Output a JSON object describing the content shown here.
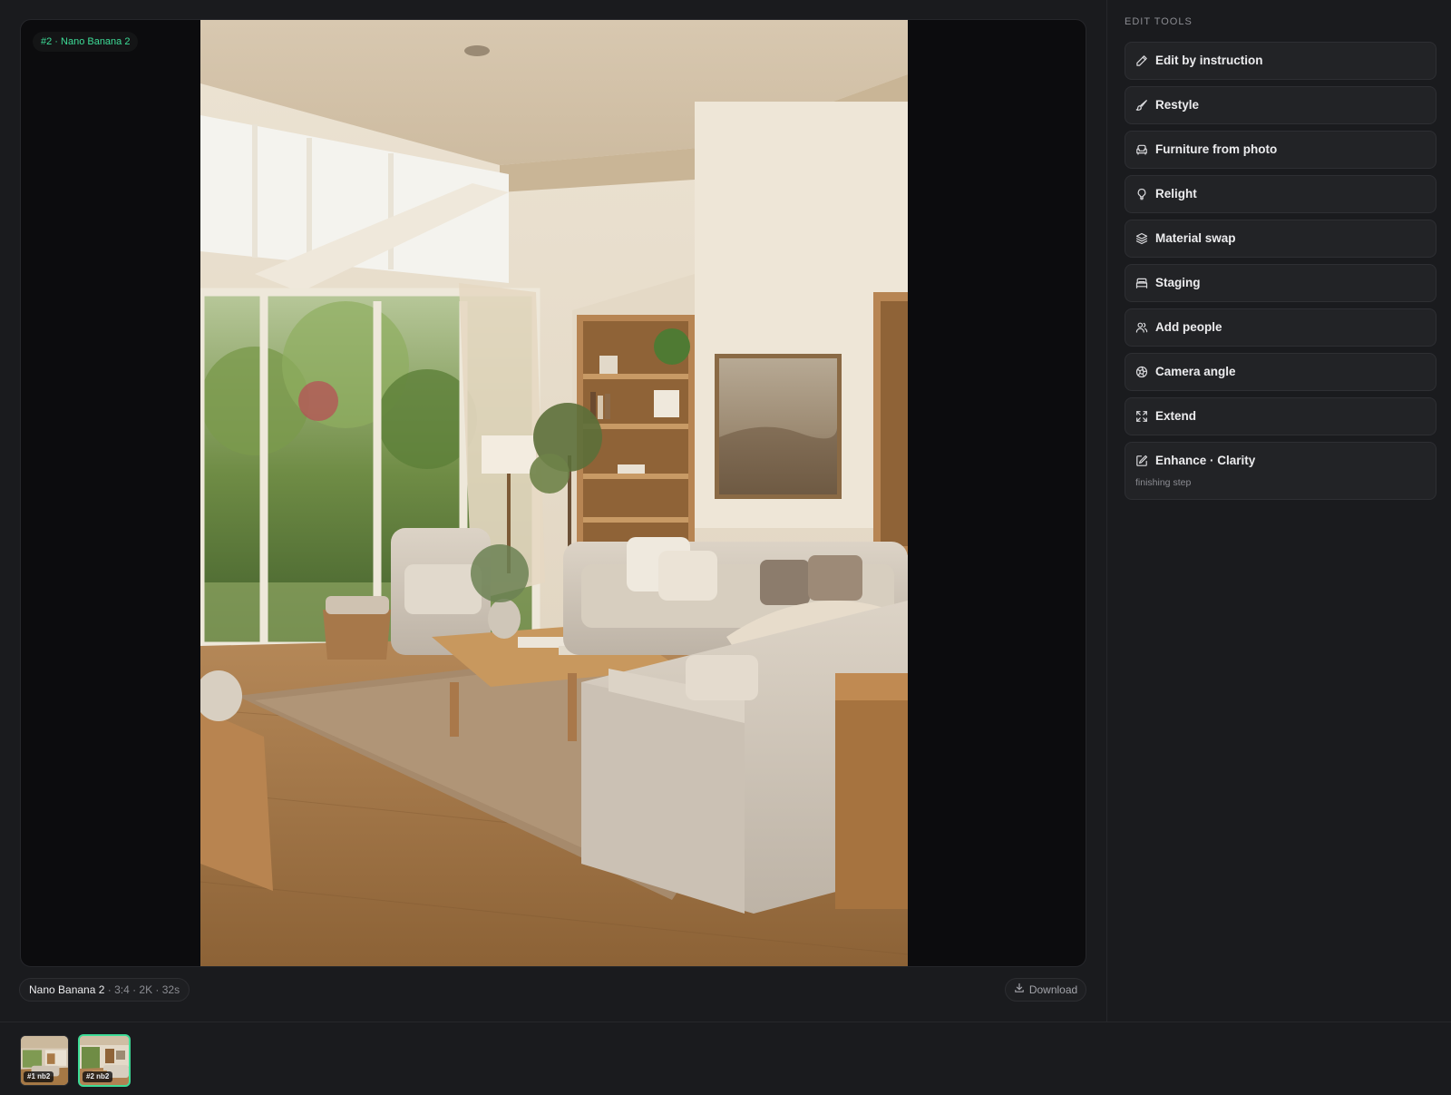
{
  "viewer": {
    "badge": "#2 · Nano Banana 2",
    "image_alt": "Living room interior render"
  },
  "meta": {
    "model": "Nano Banana 2",
    "details": " · 3:4 · 2K · 32s"
  },
  "download": {
    "label": "Download",
    "icon": "download-icon"
  },
  "sidebar": {
    "title": "EDIT TOOLS",
    "tools": [
      {
        "label": "Edit by instruction",
        "icon": "pencil-icon"
      },
      {
        "label": "Restyle",
        "icon": "paint-brush-icon"
      },
      {
        "label": "Furniture from photo",
        "icon": "armchair-icon"
      },
      {
        "label": "Relight",
        "icon": "lightbulb-icon"
      },
      {
        "label": "Material swap",
        "icon": "layers-icon"
      },
      {
        "label": "Staging",
        "icon": "bed-icon"
      },
      {
        "label": "Add people",
        "icon": "users-icon"
      },
      {
        "label": "Camera angle",
        "icon": "camera-aperture-icon"
      },
      {
        "label": "Extend",
        "icon": "expand-icon"
      },
      {
        "label": "Enhance · Clarity",
        "sub": "finishing step",
        "icon": "enhance-icon"
      }
    ]
  },
  "history": {
    "items": [
      {
        "label": "#1 nb2",
        "selected": false
      },
      {
        "label": "#2 nb2",
        "selected": true
      }
    ],
    "accent": "#3ddc97"
  }
}
